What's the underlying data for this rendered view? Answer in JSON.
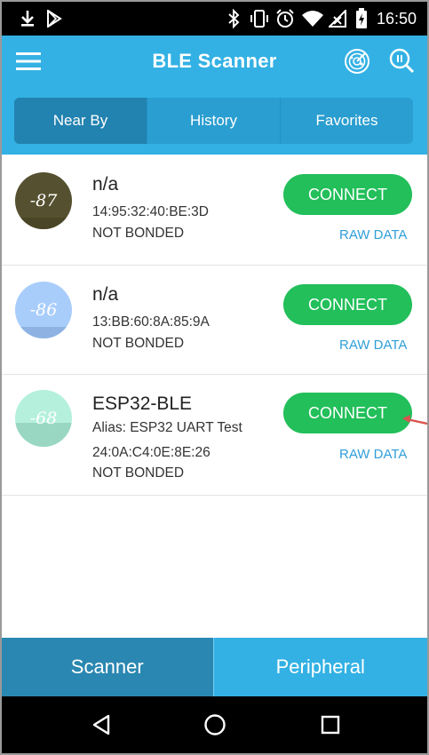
{
  "status_bar": {
    "time": "16:50"
  },
  "app_bar": {
    "title": "BLE Scanner"
  },
  "tabs": [
    {
      "label": "Near By",
      "active": true
    },
    {
      "label": "History",
      "active": false
    },
    {
      "label": "Favorites",
      "active": false
    }
  ],
  "devices": [
    {
      "rssi": "-87",
      "name": "n/a",
      "alias": "",
      "address": "14:95:32:40:BE:3D",
      "bond": "NOT BONDED",
      "connect_label": "CONNECT",
      "raw_label": "RAW DATA",
      "signal_color": "#55502f",
      "signal_fill_color": "#4a4527",
      "signal_fill_fraction": 0.2
    },
    {
      "rssi": "-86",
      "name": "n/a",
      "alias": "",
      "address": "13:BB:60:8A:85:9A",
      "bond": "NOT BONDED",
      "connect_label": "CONNECT",
      "raw_label": "RAW DATA",
      "signal_color": "#a9cdfb",
      "signal_fill_color": "#8eb3e3",
      "signal_fill_fraction": 0.2
    },
    {
      "rssi": "-68",
      "name": "ESP32-BLE",
      "alias": "Alias: ESP32 UART Test",
      "address": "24:0A:C4:0E:8E:26",
      "bond": "NOT BONDED",
      "connect_label": "CONNECT",
      "raw_label": "RAW DATA",
      "signal_color": "#b4f0dc",
      "signal_fill_color": "#9ad7c2",
      "signal_fill_fraction": 0.42
    }
  ],
  "bottom_nav": {
    "scanner": "Scanner",
    "peripheral": "Peripheral"
  },
  "colors": {
    "primary": "#33b1e4",
    "connect": "#22bf5a",
    "raw_link": "#2f9ed8",
    "annotation_arrow": "#d9534f"
  }
}
